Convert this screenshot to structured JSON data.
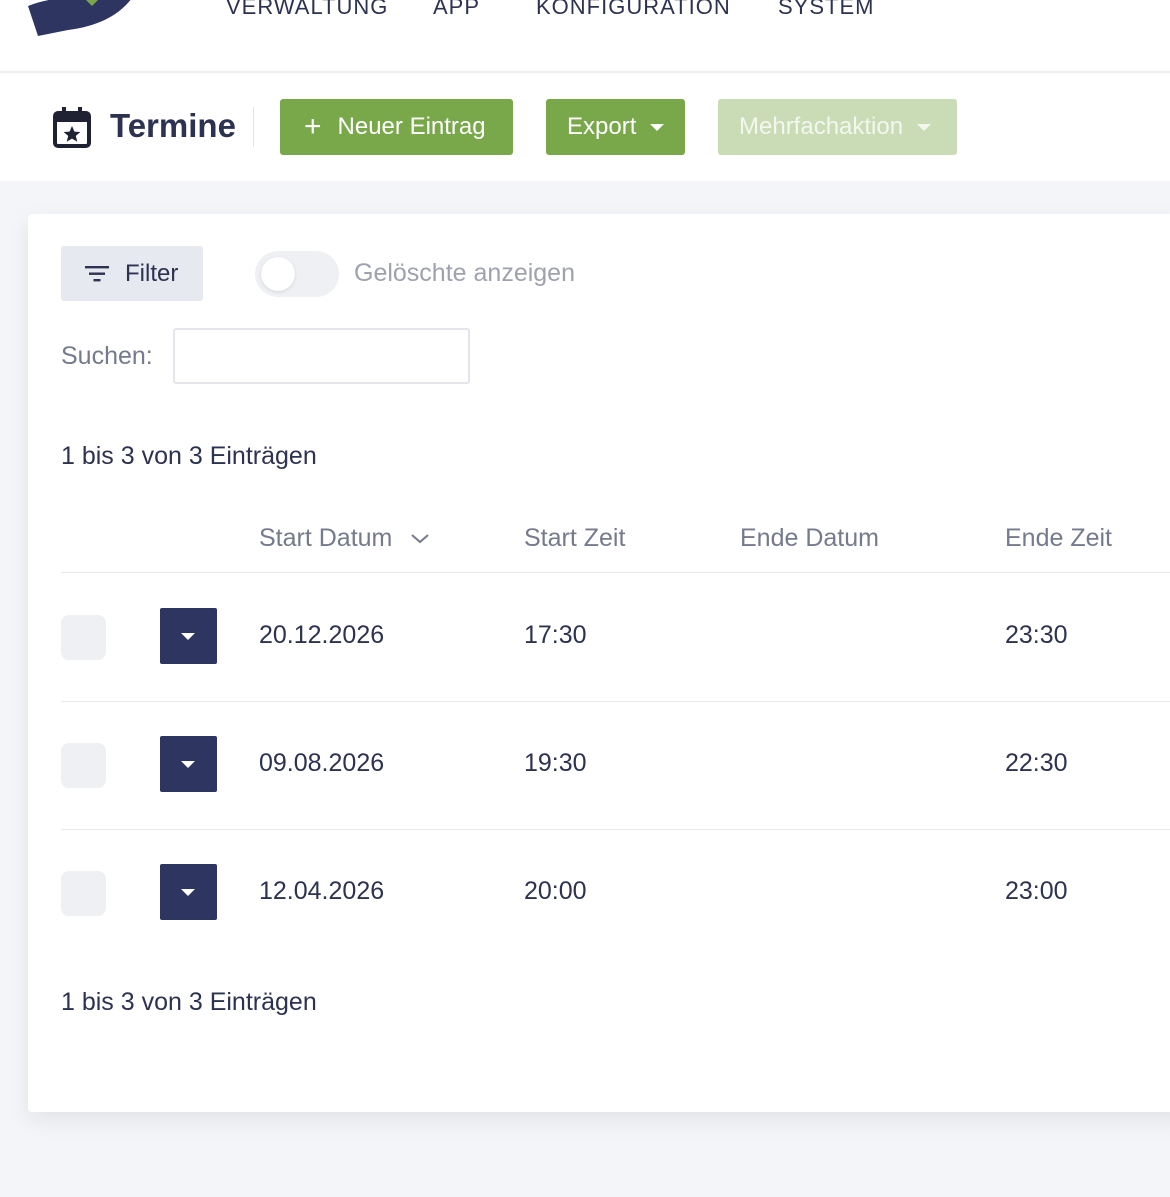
{
  "nav": {
    "items": [
      "VERWALTUNG",
      "APP",
      "KONFIGURATION",
      "SYSTEM"
    ]
  },
  "toolbar": {
    "title": "Termine",
    "new_label": "Neuer Eintrag",
    "export_label": "Export",
    "multi_label": "Mehrfachaktion"
  },
  "filters": {
    "filter_label": "Filter",
    "show_deleted_label": "Gelöschte anzeigen",
    "show_deleted_on": false,
    "search_label": "Suchen:",
    "search_value": ""
  },
  "table": {
    "info_top": "1 bis 3 von 3 Einträgen",
    "info_bottom": "1 bis 3 von 3 Einträgen",
    "columns": [
      "Start Datum",
      "Start Zeit",
      "Ende Datum",
      "Ende Zeit"
    ],
    "rows": [
      {
        "start_date": "20.12.2026",
        "start_time": "17:30",
        "end_date": "",
        "end_time": "23:30"
      },
      {
        "start_date": "09.08.2026",
        "start_time": "19:30",
        "end_date": "",
        "end_time": "22:30"
      },
      {
        "start_date": "12.04.2026",
        "start_time": "20:00",
        "end_date": "",
        "end_time": "23:00"
      }
    ]
  },
  "colors": {
    "primary_green": "#79a84a",
    "disabled_green": "#c9dcb6",
    "navy": "#2e3560",
    "text": "#2d3250",
    "muted": "#757a8c"
  },
  "icons": {
    "logo": "brand-logo",
    "title": "calendar-star-icon",
    "new": "plus-icon",
    "filter": "filter-lines-icon",
    "sort": "chevron-down-icon",
    "row_action": "caret-down-icon"
  }
}
